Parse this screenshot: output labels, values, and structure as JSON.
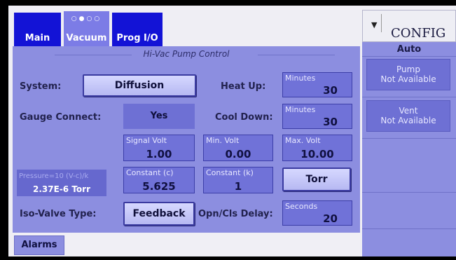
{
  "tabs": {
    "main": "Main",
    "vacuum": "Vacuum",
    "vacuum_dots": "○●○○",
    "prog": "Prog I/O"
  },
  "panel": {
    "title": "Hi-Vac Pump Control",
    "system_label": "System:",
    "system_value": "Diffusion",
    "gauge_label": "Gauge Connect:",
    "gauge_value": "Yes",
    "heat_label": "Heat Up:",
    "heat": {
      "caption": "Minutes",
      "value": "30"
    },
    "cool_label": "Cool Down:",
    "cool": {
      "caption": "Minutes",
      "value": "30"
    },
    "signal": {
      "caption": "Signal Volt",
      "value": "1.00"
    },
    "minv": {
      "caption": "Min. Volt",
      "value": "0.00"
    },
    "maxv": {
      "caption": "Max. Volt",
      "value": "10.00"
    },
    "pressure_formula": "Pressure=10 (V-c)/k",
    "pressure_reading": "2.37E-6 Torr",
    "constc": {
      "caption": "Constant (c)",
      "value": "5.625"
    },
    "constk": {
      "caption": "Constant (k)",
      "value": "1"
    },
    "unit_button": "Torr",
    "iso_label": "Iso-Valve Type:",
    "iso_value": "Feedback",
    "delay_label": "Opn/Cls Delay:",
    "delay": {
      "caption": "Seconds",
      "value": "20"
    }
  },
  "bottom": {
    "alarms": "Alarms"
  },
  "side": {
    "config": "CONFIG",
    "mode": "Auto",
    "pump": {
      "title": "Pump",
      "status": "Not Available"
    },
    "vent": {
      "title": "Vent",
      "status": "Not Available"
    }
  },
  "colors": {
    "tab": "#1313d6",
    "panel": "#8c8ee0",
    "field": "#7072d8"
  }
}
